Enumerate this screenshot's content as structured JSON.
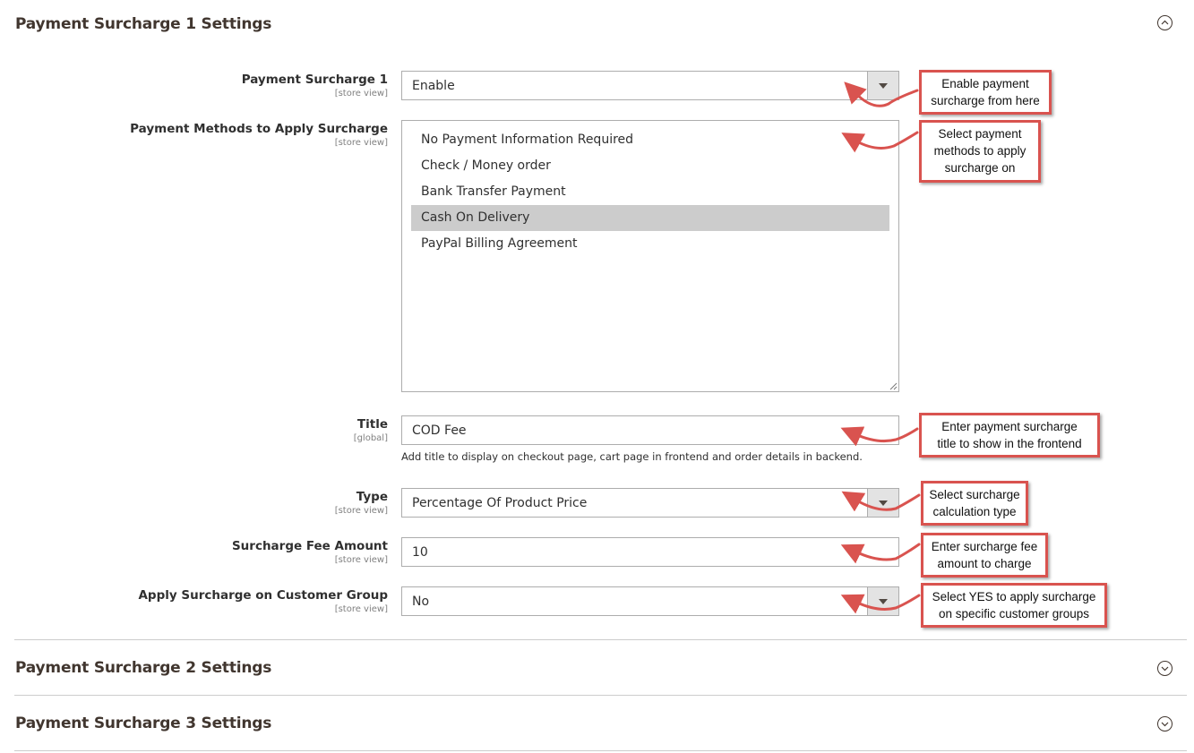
{
  "sections": [
    {
      "title": "Payment Surcharge 1 Settings",
      "state": "expanded"
    },
    {
      "title": "Payment Surcharge 2 Settings",
      "state": "collapsed"
    },
    {
      "title": "Payment Surcharge 3 Settings",
      "state": "collapsed"
    }
  ],
  "fields": {
    "surcharge_enable": {
      "label": "Payment Surcharge 1",
      "scope": "[store view]",
      "value": "Enable"
    },
    "payment_methods": {
      "label": "Payment Methods to Apply Surcharge",
      "scope": "[store view]",
      "options": [
        {
          "label": "No Payment Information Required",
          "selected": false
        },
        {
          "label": "Check / Money order",
          "selected": false
        },
        {
          "label": "Bank Transfer Payment",
          "selected": false
        },
        {
          "label": "Cash On Delivery",
          "selected": true
        },
        {
          "label": "PayPal Billing Agreement",
          "selected": false
        }
      ]
    },
    "title": {
      "label": "Title",
      "scope": "[global]",
      "value": "COD Fee",
      "note": "Add title to display on checkout page, cart page in frontend and order details in backend."
    },
    "type": {
      "label": "Type",
      "scope": "[store view]",
      "value": "Percentage Of Product Price"
    },
    "fee_amount": {
      "label": "Surcharge Fee Amount",
      "scope": "[store view]",
      "value": "10"
    },
    "customer_group": {
      "label": "Apply Surcharge on Customer Group",
      "scope": "[store view]",
      "value": "No"
    }
  },
  "callouts": {
    "enable": [
      "Enable payment",
      "surcharge from here"
    ],
    "methods": [
      "Select payment",
      "methods to apply",
      "surcharge on"
    ],
    "title": [
      "Enter payment surcharge",
      "title to show in the frontend"
    ],
    "type": [
      "Select surcharge",
      "calculation type"
    ],
    "amount": [
      "Enter surcharge fee",
      "amount to charge"
    ],
    "group": [
      "Select YES to apply surcharge",
      "on specific customer groups"
    ]
  },
  "colors": {
    "callout_border": "#d9534f",
    "selected_option": "#cccccc",
    "heading": "#41362f"
  },
  "icons": {
    "expanded": "chevron-up-circle-icon",
    "collapsed": "chevron-down-circle-icon",
    "dropdown": "caret-down-icon"
  }
}
